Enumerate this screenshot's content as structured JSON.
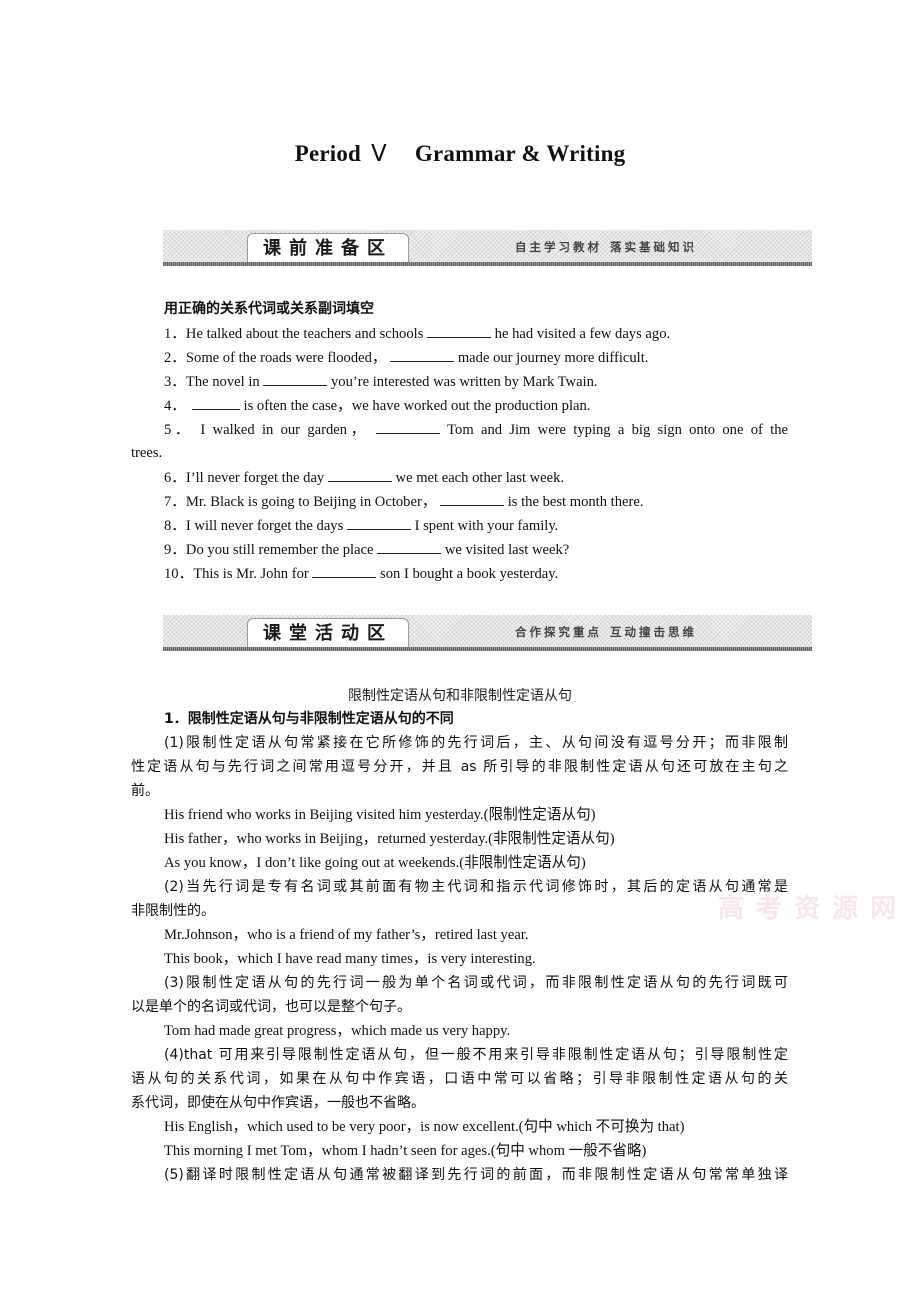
{
  "document": {
    "title_main": "Period",
    "title_roman": "Ⅴ",
    "title_sub": "Grammar & Writing"
  },
  "banner_pre_class": {
    "tab_label": "课前准备区",
    "tagline_1": "自主学习教材",
    "tagline_2": "落实基础知识"
  },
  "exercise": {
    "instruction": "用正确的关系代词或关系副词填空",
    "items": [
      {
        "num": "1．",
        "before": "He talked about the teachers and schools ",
        "after": " he had visited a few days ago."
      },
      {
        "num": "2．",
        "before": "Some of the roads were flooded， ",
        "after": " made our journey more difficult."
      },
      {
        "num": "3．",
        "before": "The novel in ",
        "after": " you’re interested was written by Mark Twain."
      },
      {
        "num": "4．",
        "before": "",
        "after": " is often the case，we have worked out the production plan."
      },
      {
        "num": "5．",
        "before": "I walked in our garden， ",
        "after": " Tom and Jim were typing a big sign onto one of the",
        "continuation": "trees."
      },
      {
        "num": "6．",
        "before": "I’ll never forget the day ",
        "after": " we met each other last week."
      },
      {
        "num": "7．",
        "before": "Mr. Black is going to Beijing in October， ",
        "after": " is the best month there."
      },
      {
        "num": "8．",
        "before": "I will never forget the days ",
        "after": " I spent with your family."
      },
      {
        "num": "9．",
        "before": "Do you still remember the place ",
        "after": " we visited last week?"
      },
      {
        "num": "10．",
        "before": "This is Mr. John for ",
        "after": " son I bought a book yesterday."
      }
    ]
  },
  "banner_in_class": {
    "tab_label": "课堂活动区",
    "tagline_1": "合作探究重点",
    "tagline_2": "互动撞击思维"
  },
  "lesson": {
    "topic": "限制性定语从句和非限制性定语从句",
    "section1_heading": "1．限制性定语从句与非限制性定语从句的不同",
    "p1_line1": "(1)限制性定语从句常紧接在它所修饰的先行词后，主、从句间没有逗号分开；而非限制",
    "p1_line2": "性定语从句与先行词之间常用逗号分开，并且 as 所引导的非限制性定语从句还可放在主句之",
    "p1_line3": "前。",
    "ex1a": "His friend who works in Beijing visited him yesterday.(限制性定语从句)",
    "ex1b": "His father，who works in Beijing，returned yesterday.(非限制性定语从句)",
    "ex1c": "As you know，I don’t like going out at weekends.(非限制性定语从句)",
    "p2_line1": "(2)当先行词是专有名词或其前面有物主代词和指示代词修饰时，其后的定语从句通常是",
    "p2_line2": "非限制性的。",
    "ex2a": "Mr.Johnson，who is a friend of my father’s，retired last year.",
    "ex2b": "This book，which I have read many times，is very interesting.",
    "p3_line1": "(3)限制性定语从句的先行词一般为单个名词或代词，而非限制性定语从句的先行词既可",
    "p3_line2": "以是单个的名词或代词，也可以是整个句子。",
    "ex3a": "Tom had made great progress，which made us very happy.",
    "p4_line1": "(4)that 可用来引导限制性定语从句，但一般不用来引导非限制性定语从句；引导限制性定",
    "p4_line2": "语从句的关系代词，如果在从句中作宾语，口语中常可以省略；引导非限制性定语从句的关",
    "p4_line3": "系代词，即使在从句中作宾语，一般也不省略。",
    "ex4a": "His English，which used to be very poor，is now excellent.(句中 which 不可换为 that)",
    "ex4b": "This morning I met Tom，whom I hadn’t seen for ages.(句中 whom 一般不省略)",
    "p5_line1": "(5)翻译时限制性定语从句通常被翻译到先行词的前面，而非限制性定语从句常常单独译"
  },
  "watermark": {
    "text": "高考资源网"
  }
}
